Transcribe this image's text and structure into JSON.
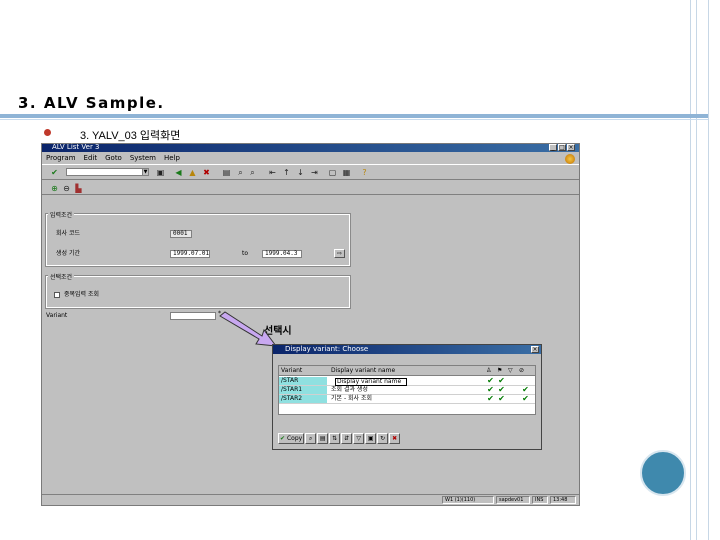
{
  "slide": {
    "title": "3. ALV Sample.",
    "bullet": "3. YALV_03 입력화면"
  },
  "window": {
    "title": "ALV List Ver 3",
    "menu": [
      "Program",
      "Edit",
      "Goto",
      "System",
      "Help"
    ],
    "toolbar_icons": [
      "enter-icon",
      "save-icon",
      "back-icon",
      "exit-icon",
      "cancel-icon",
      "print-icon",
      "find-icon",
      "find-next-icon",
      "first-page-icon",
      "prev-page-icon",
      "next-page-icon",
      "last-page-icon",
      "create-session-icon",
      "shortcut-icon",
      "help-icon"
    ],
    "app_icons": [
      "execute-icon",
      "get-variant-icon",
      "save-variant-icon"
    ]
  },
  "form": {
    "group1_title": "입력조건",
    "company_label": "회사 코드",
    "company_value": "0001",
    "period_label": "생성 기간",
    "period_from": "1999.07.01",
    "to_label": "to",
    "period_to": "1999.04.3",
    "group2_title": "선택조건",
    "checkbox_label": "중복입력 조회",
    "variant_label": "Variant",
    "variant_value": ""
  },
  "callout": "선택시",
  "status": {
    "cells": [
      "W1 (1)(110)",
      "sapdev01",
      "INS",
      "13:48"
    ]
  },
  "dialog": {
    "title": "Display variant: Choose",
    "col_variant": "Variant",
    "col_name": "Display variant name",
    "edit_placeholder": "Display variant name",
    "rows": [
      {
        "variant": "/STAR",
        "name": "",
        "c1": "✔",
        "c2": "✔",
        "c3": ""
      },
      {
        "variant": "/STAR1",
        "name": "조회 결과 생성",
        "c1": "✔",
        "c2": "✔",
        "c3": "✔"
      },
      {
        "variant": "/STAR2",
        "name": "기본 - 회사 조회",
        "c1": "✔",
        "c2": "✔",
        "c3": "✔"
      }
    ],
    "copy_label": "Copy"
  },
  "colors": {
    "accent_rule": "#8fb4d6",
    "title_blue": "#0a246a",
    "circle": "#3f89ad",
    "variant_cell": "#8fe0e0",
    "arrow": "#c8a8f0"
  }
}
